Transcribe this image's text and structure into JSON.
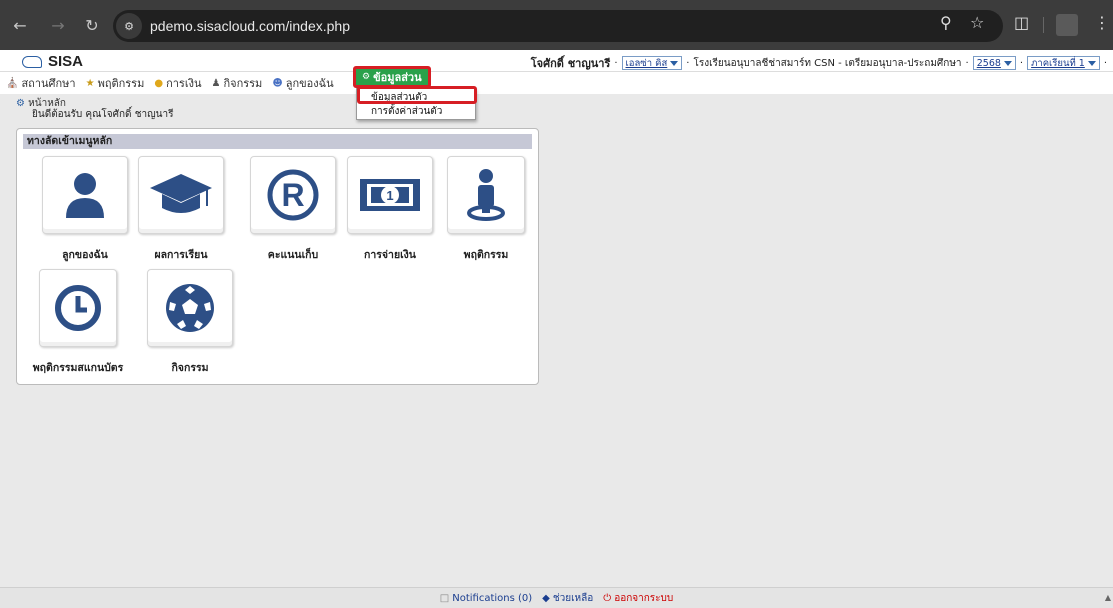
{
  "browser": {
    "url": "pdemo.sisacloud.com/index.php",
    "back_icon": "arrow-left-icon",
    "forward_icon": "arrow-right-icon",
    "reload_icon": "reload-icon"
  },
  "header": {
    "logo_text": "SISA",
    "user_name": "โจศักดิ์ ชาญนารี",
    "role_select": "เอลซ่า คิส",
    "school": "โรงเรียนอนุบาลชีช่าสมาร์ท CSN - เตรียมอนุบาล-ประถมศึกษา",
    "year_select": "2568",
    "term_select": "ภาคเรียนที่ 1"
  },
  "menu": {
    "items": [
      {
        "label": "สถานศึกษา"
      },
      {
        "label": "พฤติกรรม"
      },
      {
        "label": "การเงิน"
      },
      {
        "label": "กิจกรรม"
      },
      {
        "label": "ลูกของฉัน"
      }
    ],
    "active_label": "ข้อมูลส่วน",
    "dropdown": [
      {
        "label": "ข้อมูลส่วนตัว"
      },
      {
        "label": "การตั้งค่าส่วนตัว"
      }
    ]
  },
  "breadcrumb": {
    "home": "หน้าหลัก",
    "welcome": "ยินดีต้อนรับ คุณโจศักดิ์ ชาญนารี"
  },
  "panel": {
    "title": "ทางลัดเข้าเมนูหลัก",
    "tiles": [
      {
        "label": "ลูกของฉัน",
        "icon": "user-icon"
      },
      {
        "label": "ผลการเรียน",
        "icon": "graduation-cap-icon"
      },
      {
        "label": "คะแนนเก็บ",
        "icon": "registered-icon"
      },
      {
        "label": "การจ่ายเงิน",
        "icon": "money-icon"
      },
      {
        "label": "พฤติกรรม",
        "icon": "person-pin-icon"
      },
      {
        "label": "พฤติกรรมสแกนบัตร",
        "icon": "clock-icon"
      },
      {
        "label": "กิจกรรม",
        "icon": "soccer-ball-icon"
      }
    ]
  },
  "footer": {
    "notifications": "Notifications (0)",
    "help": "ช่วยเหลือ",
    "logout": "ออกจากระบบ"
  },
  "colors": {
    "icon_blue": "#2d4f86",
    "active_menu": "#2aa14a",
    "highlight": "#d61e24"
  }
}
